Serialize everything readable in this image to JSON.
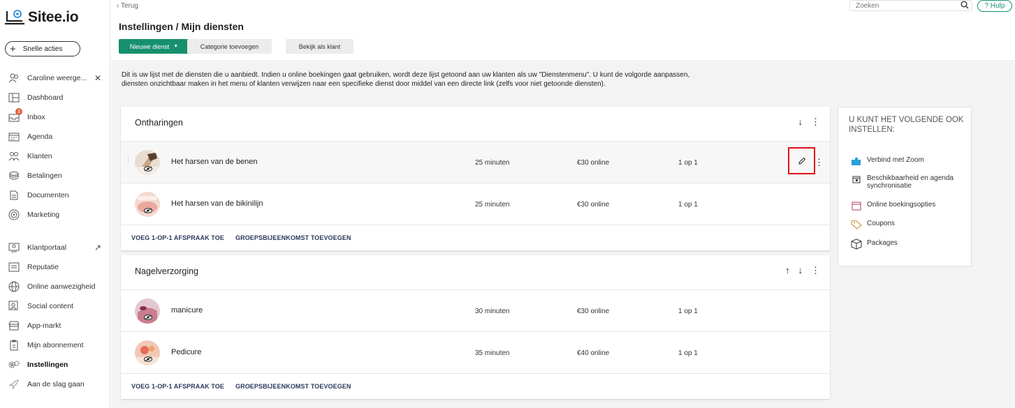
{
  "app": {
    "logo_text": "Sitee.io",
    "quick_actions": "Snelle acties"
  },
  "sidebar": {
    "items": [
      {
        "label": "Caroline weerge...",
        "icon": "users-icon"
      },
      {
        "label": "Dashboard",
        "icon": "dashboard-icon"
      },
      {
        "label": "Inbox",
        "icon": "inbox-icon",
        "badge": "3"
      },
      {
        "label": "Agenda",
        "icon": "calendar-icon"
      },
      {
        "label": "Klanten",
        "icon": "clients-icon"
      },
      {
        "label": "Betalingen",
        "icon": "payments-icon"
      },
      {
        "label": "Documenten",
        "icon": "document-icon"
      },
      {
        "label": "Marketing",
        "icon": "marketing-icon"
      },
      {
        "label": "Klantportaal",
        "icon": "portal-icon"
      },
      {
        "label": "Reputatie",
        "icon": "reputation-icon"
      },
      {
        "label": "Online aanwezigheid",
        "icon": "globe-icon"
      },
      {
        "label": "Social content",
        "icon": "social-icon"
      },
      {
        "label": "App-markt",
        "icon": "store-icon"
      },
      {
        "label": "Mijn abonnement",
        "icon": "subscription-icon"
      },
      {
        "label": "Instellingen",
        "icon": "settings-icon"
      },
      {
        "label": "Aan de slag gaan",
        "icon": "rocket-icon"
      }
    ]
  },
  "header": {
    "back": "Terug",
    "title": "Instellingen / Mijn diensten",
    "btn_new": "Nieuwe dienst",
    "btn_category": "Categorie toevoegen",
    "btn_view": "Bekijk als klant",
    "search_placeholder": "Zoeken",
    "help": "Hulp"
  },
  "intro": "Dit is uw lijst met de diensten die u aanbiedt. Indien u online boekingen gaat gebruiken, wordt deze lijst getoond aan uw klanten als uw \"Dienstenmenu\". U kunt de volgorde aanpassen, diensten onzichtbaar maken in het menu of klanten verwijzen naar een specifieke dienst door middel van een directe link (zelfs voor niet getoonde diensten).",
  "categories": [
    {
      "title": "Ontharingen",
      "services": [
        {
          "name": "Het harsen van de benen",
          "duration": "25 minuten",
          "price": "€30 online",
          "capacity": "1 op 1"
        },
        {
          "name": "Het harsen van de bikinilijn",
          "duration": "25 minuten",
          "price": "€30 online",
          "capacity": "1 op 1"
        }
      ],
      "foot_one": "VOEG 1-OP-1 AFSPRAAK TOE",
      "foot_group": "GROEPSBIJEENKOMST TOEVOEGEN"
    },
    {
      "title": "Nagelverzorging",
      "services": [
        {
          "name": "manicure",
          "duration": "30 minuten",
          "price": "€30 online",
          "capacity": "1 op 1"
        },
        {
          "name": "Pedicure",
          "duration": "35 minuten",
          "price": "€40 online",
          "capacity": "1 op 1"
        }
      ],
      "foot_one": "VOEG 1-OP-1 AFSPRAAK TOE",
      "foot_group": "GROEPSBIJEENKOMST TOEVOEGEN"
    }
  ],
  "panel": {
    "title": "U KUNT HET VOLGENDE OOK INSTELLEN:",
    "items": [
      {
        "label": "Verbind met Zoom",
        "icon": "puzzle-icon"
      },
      {
        "label": "Beschikbaarheid en agenda synchronisatie",
        "icon": "calendar-sync-icon"
      },
      {
        "label": "Online boekingsopties",
        "icon": "calendar-icon"
      },
      {
        "label": "Coupons",
        "icon": "tag-icon"
      },
      {
        "label": "Packages",
        "icon": "box-icon"
      }
    ]
  },
  "colors": {
    "primary": "#17906f",
    "highlight": "#e0101a",
    "badge": "#e5603c"
  }
}
